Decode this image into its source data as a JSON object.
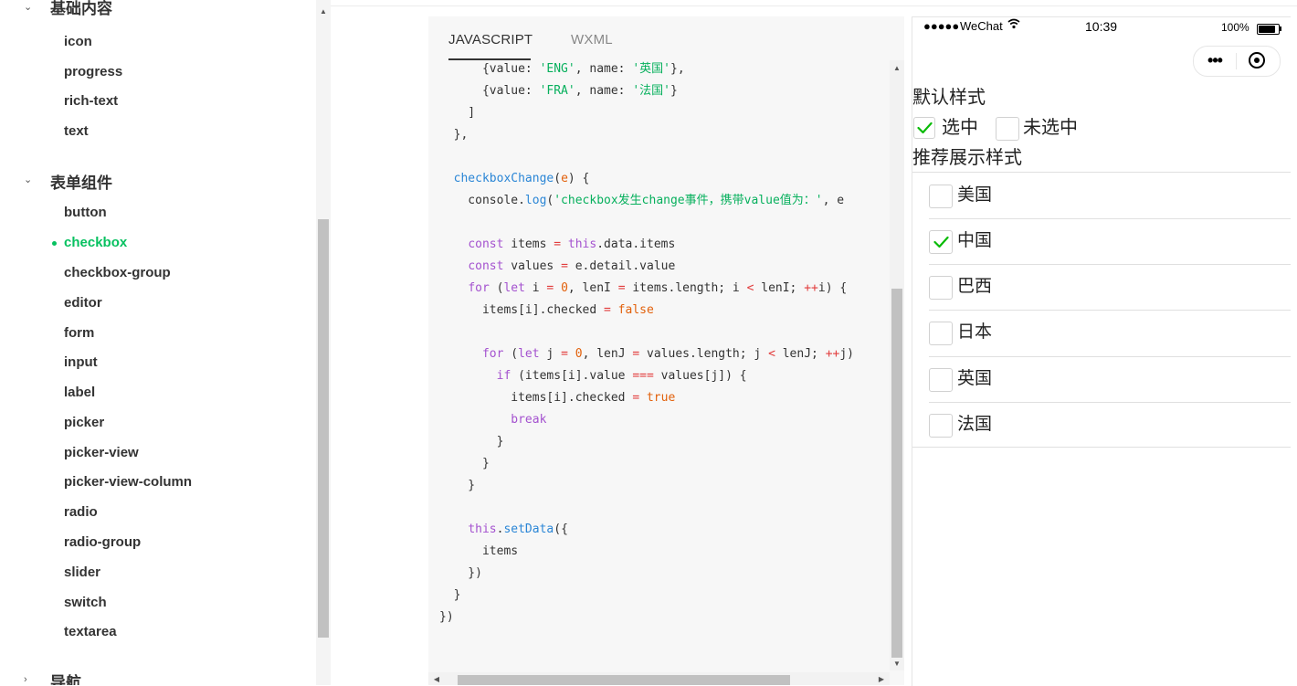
{
  "sidebar": {
    "partial_section": {
      "title": "基础内容"
    },
    "basic_items": [
      "icon",
      "progress",
      "rich-text",
      "text"
    ],
    "form_section": {
      "title": "表单组件",
      "items": [
        "button",
        "checkbox",
        "checkbox-group",
        "editor",
        "form",
        "input",
        "label",
        "picker",
        "picker-view",
        "picker-view-column",
        "radio",
        "radio-group",
        "slider",
        "switch",
        "textarea"
      ],
      "active": "checkbox"
    },
    "nav_section": {
      "title": "导航"
    }
  },
  "code_panel": {
    "tabs": [
      {
        "label": "JAVASCRIPT",
        "active": true
      },
      {
        "label": "WXML",
        "active": false
      }
    ]
  },
  "phone": {
    "status_bar": {
      "signal": "●●●●●",
      "carrier": "WeChat",
      "time": "10:39",
      "battery": "100%"
    },
    "section_default": "默认样式",
    "default_checkboxes": [
      {
        "label": "选中",
        "checked": true
      },
      {
        "label": "未选中",
        "checked": false
      }
    ],
    "section_recommended": "推荐展示样式",
    "list_items": [
      {
        "label": "美国",
        "checked": false
      },
      {
        "label": "中国",
        "checked": true
      },
      {
        "label": "巴西",
        "checked": false
      },
      {
        "label": "日本",
        "checked": false
      },
      {
        "label": "英国",
        "checked": false
      },
      {
        "label": "法国",
        "checked": false
      }
    ],
    "check_color": "#09bb07"
  },
  "colors": {
    "accent": "#07c160"
  }
}
